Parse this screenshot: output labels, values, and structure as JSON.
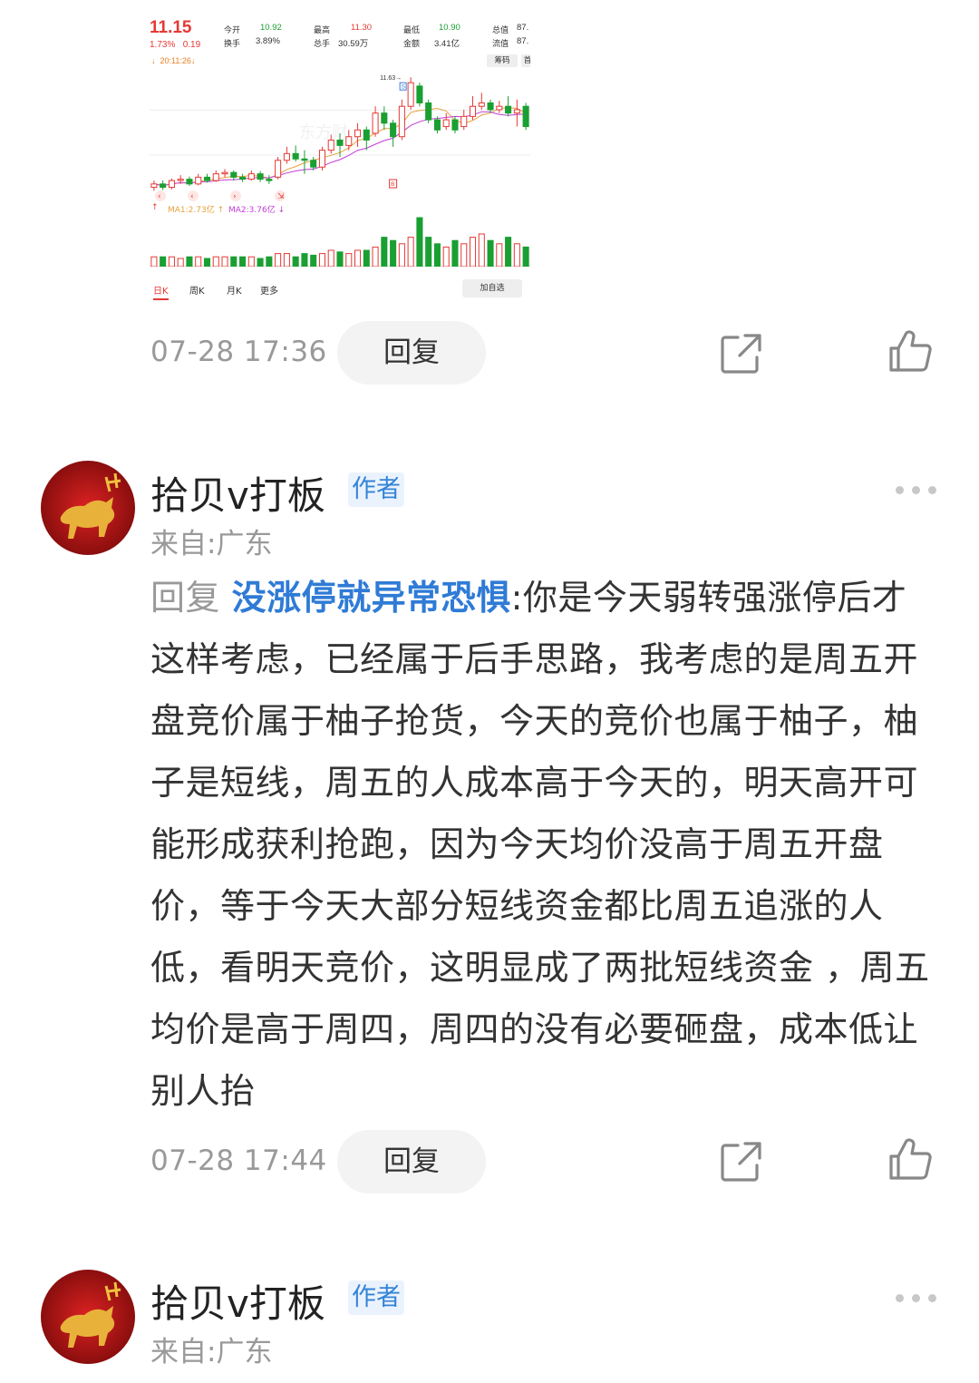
{
  "stock_snapshot": {
    "price": "11.15",
    "change_pct": "1.73%",
    "change_amt": "0.19",
    "time_label": "20:11:26",
    "quotes": [
      {
        "label": "今开",
        "value": "10.92",
        "tone": "green"
      },
      {
        "label": "换手",
        "value": "3.89%",
        "tone": "dark"
      },
      {
        "label": "最高",
        "value": "11.30",
        "tone": "red"
      },
      {
        "label": "总手",
        "value": "30.59万",
        "tone": "dark"
      },
      {
        "label": "最低",
        "value": "10.90",
        "tone": "green"
      },
      {
        "label": "金额",
        "value": "3.41亿",
        "tone": "dark"
      },
      {
        "label": "总值",
        "value": "87.",
        "tone": "dark"
      },
      {
        "label": "流值",
        "value": "87.",
        "tone": "dark"
      }
    ],
    "chip_button": "筹码",
    "chip_button2": "首",
    "high_marker": "11.63",
    "sell_marker": "S",
    "buy_marker": "B",
    "watermark": "东方财",
    "ma1_label": "MA1:2.73亿",
    "ma2_label": "MA2:3.76亿",
    "tabs": [
      "日K",
      "周K",
      "月K",
      "更多"
    ],
    "add_watchlist": "加自选",
    "colors": {
      "up": "#e53935",
      "down": "#1a9f32"
    }
  },
  "comments": [
    {
      "timestamp": "07-28 17:36",
      "reply_label": "回复"
    },
    {
      "username": "拾贝v打板",
      "badge": "作者",
      "location": "来自:广东",
      "reply_prefix": "回复 ",
      "mention": "没涨停就异常恐惧",
      "separator": ":",
      "body": "你是今天弱转强涨停后才这样考虑，已经属于后手思路，我考虑的是周五开盘竞价属于柚子抢货，今天的竞价也属于柚子，柚子是短线，周五的人成本高于今天的，明天高开可能形成获利抢跑，因为今天均价没高于周五开盘价，等于今天大部分短线资金都比周五追涨的人低，看明天竞价，这明显成了两批短线资金 ，周五均价是高于周四，周四的没有必要砸盘，成本低让别人抬",
      "timestamp": "07-28 17:44",
      "reply_label": "回复"
    },
    {
      "username": "拾贝v打板",
      "badge": "作者",
      "location": "来自:广东"
    }
  ],
  "icons": {
    "share": "share-icon",
    "like": "thumbs-up-icon",
    "more": "more-dots-icon"
  },
  "chart_data": {
    "type": "candlestick",
    "title": "",
    "candles": [
      {
        "o": 10.0,
        "c": 10.05,
        "h": 10.1,
        "l": 9.95
      },
      {
        "o": 10.05,
        "c": 10.0,
        "h": 10.1,
        "l": 9.96
      },
      {
        "o": 10.0,
        "c": 10.1,
        "h": 10.13,
        "l": 9.97
      },
      {
        "o": 10.1,
        "c": 10.12,
        "h": 10.18,
        "l": 10.05
      },
      {
        "o": 10.12,
        "c": 10.05,
        "h": 10.16,
        "l": 10.02
      },
      {
        "o": 10.05,
        "c": 10.15,
        "h": 10.2,
        "l": 10.03
      },
      {
        "o": 10.15,
        "c": 10.1,
        "h": 10.2,
        "l": 10.07
      },
      {
        "o": 10.1,
        "c": 10.2,
        "h": 10.25,
        "l": 10.08
      },
      {
        "o": 10.2,
        "c": 10.22,
        "h": 10.27,
        "l": 10.15
      },
      {
        "o": 10.22,
        "c": 10.15,
        "h": 10.25,
        "l": 10.1
      },
      {
        "o": 10.15,
        "c": 10.12,
        "h": 10.2,
        "l": 10.08
      },
      {
        "o": 10.12,
        "c": 10.2,
        "h": 10.25,
        "l": 10.1
      },
      {
        "o": 10.2,
        "c": 10.12,
        "h": 10.24,
        "l": 10.08
      },
      {
        "o": 10.12,
        "c": 10.1,
        "h": 10.18,
        "l": 10.05
      },
      {
        "o": 10.15,
        "c": 10.4,
        "h": 10.45,
        "l": 10.12
      },
      {
        "o": 10.4,
        "c": 10.5,
        "h": 10.6,
        "l": 10.35
      },
      {
        "o": 10.5,
        "c": 10.42,
        "h": 10.62,
        "l": 10.38
      },
      {
        "o": 10.42,
        "c": 10.4,
        "h": 10.55,
        "l": 10.2
      },
      {
        "o": 10.4,
        "c": 10.3,
        "h": 10.45,
        "l": 10.25
      },
      {
        "o": 10.3,
        "c": 10.55,
        "h": 10.6,
        "l": 10.25
      },
      {
        "o": 10.55,
        "c": 10.7,
        "h": 10.78,
        "l": 10.5
      },
      {
        "o": 10.7,
        "c": 10.62,
        "h": 10.8,
        "l": 10.45
      },
      {
        "o": 10.62,
        "c": 10.75,
        "h": 10.85,
        "l": 10.55
      },
      {
        "o": 10.75,
        "c": 10.85,
        "h": 10.95,
        "l": 10.6
      },
      {
        "o": 10.85,
        "c": 10.7,
        "h": 10.9,
        "l": 10.55
      },
      {
        "o": 10.8,
        "c": 11.1,
        "h": 11.2,
        "l": 10.75
      },
      {
        "o": 11.1,
        "c": 10.95,
        "h": 11.2,
        "l": 10.85
      },
      {
        "o": 10.95,
        "c": 10.75,
        "h": 11.0,
        "l": 10.6
      },
      {
        "o": 10.75,
        "c": 11.2,
        "h": 11.3,
        "l": 10.7
      },
      {
        "o": 11.2,
        "c": 11.55,
        "h": 11.63,
        "l": 11.15
      },
      {
        "o": 11.5,
        "c": 11.25,
        "h": 11.55,
        "l": 11.2
      },
      {
        "o": 11.25,
        "c": 11.0,
        "h": 11.3,
        "l": 10.95
      },
      {
        "o": 11.0,
        "c": 10.85,
        "h": 11.05,
        "l": 10.8
      },
      {
        "o": 10.9,
        "c": 11.0,
        "h": 11.1,
        "l": 10.85
      },
      {
        "o": 11.0,
        "c": 10.85,
        "h": 11.05,
        "l": 10.8
      },
      {
        "o": 10.9,
        "c": 11.05,
        "h": 11.15,
        "l": 10.85
      },
      {
        "o": 11.05,
        "c": 11.2,
        "h": 11.35,
        "l": 11.0
      },
      {
        "o": 11.2,
        "c": 11.25,
        "h": 11.4,
        "l": 11.15
      },
      {
        "o": 11.25,
        "c": 11.15,
        "h": 11.3,
        "l": 11.1
      },
      {
        "o": 11.15,
        "c": 11.2,
        "h": 11.28,
        "l": 11.1
      },
      {
        "o": 11.2,
        "c": 11.1,
        "h": 11.35,
        "l": 11.05
      },
      {
        "o": 11.1,
        "c": 11.15,
        "h": 11.3,
        "l": 10.9
      },
      {
        "o": 11.2,
        "c": 10.9,
        "h": 11.25,
        "l": 10.85
      }
    ],
    "volume": [
      3,
      3,
      3,
      2.5,
      3,
      3,
      2.5,
      3,
      3,
      3,
      3,
      3,
      2.5,
      3,
      4,
      4,
      3,
      4,
      3.5,
      4,
      5,
      4.5,
      4,
      5,
      5,
      6,
      9,
      8,
      7,
      9,
      15,
      9,
      7,
      6,
      8,
      7,
      9,
      10,
      8,
      7,
      9,
      7,
      6
    ],
    "ylim": [
      9.9,
      11.7
    ]
  }
}
